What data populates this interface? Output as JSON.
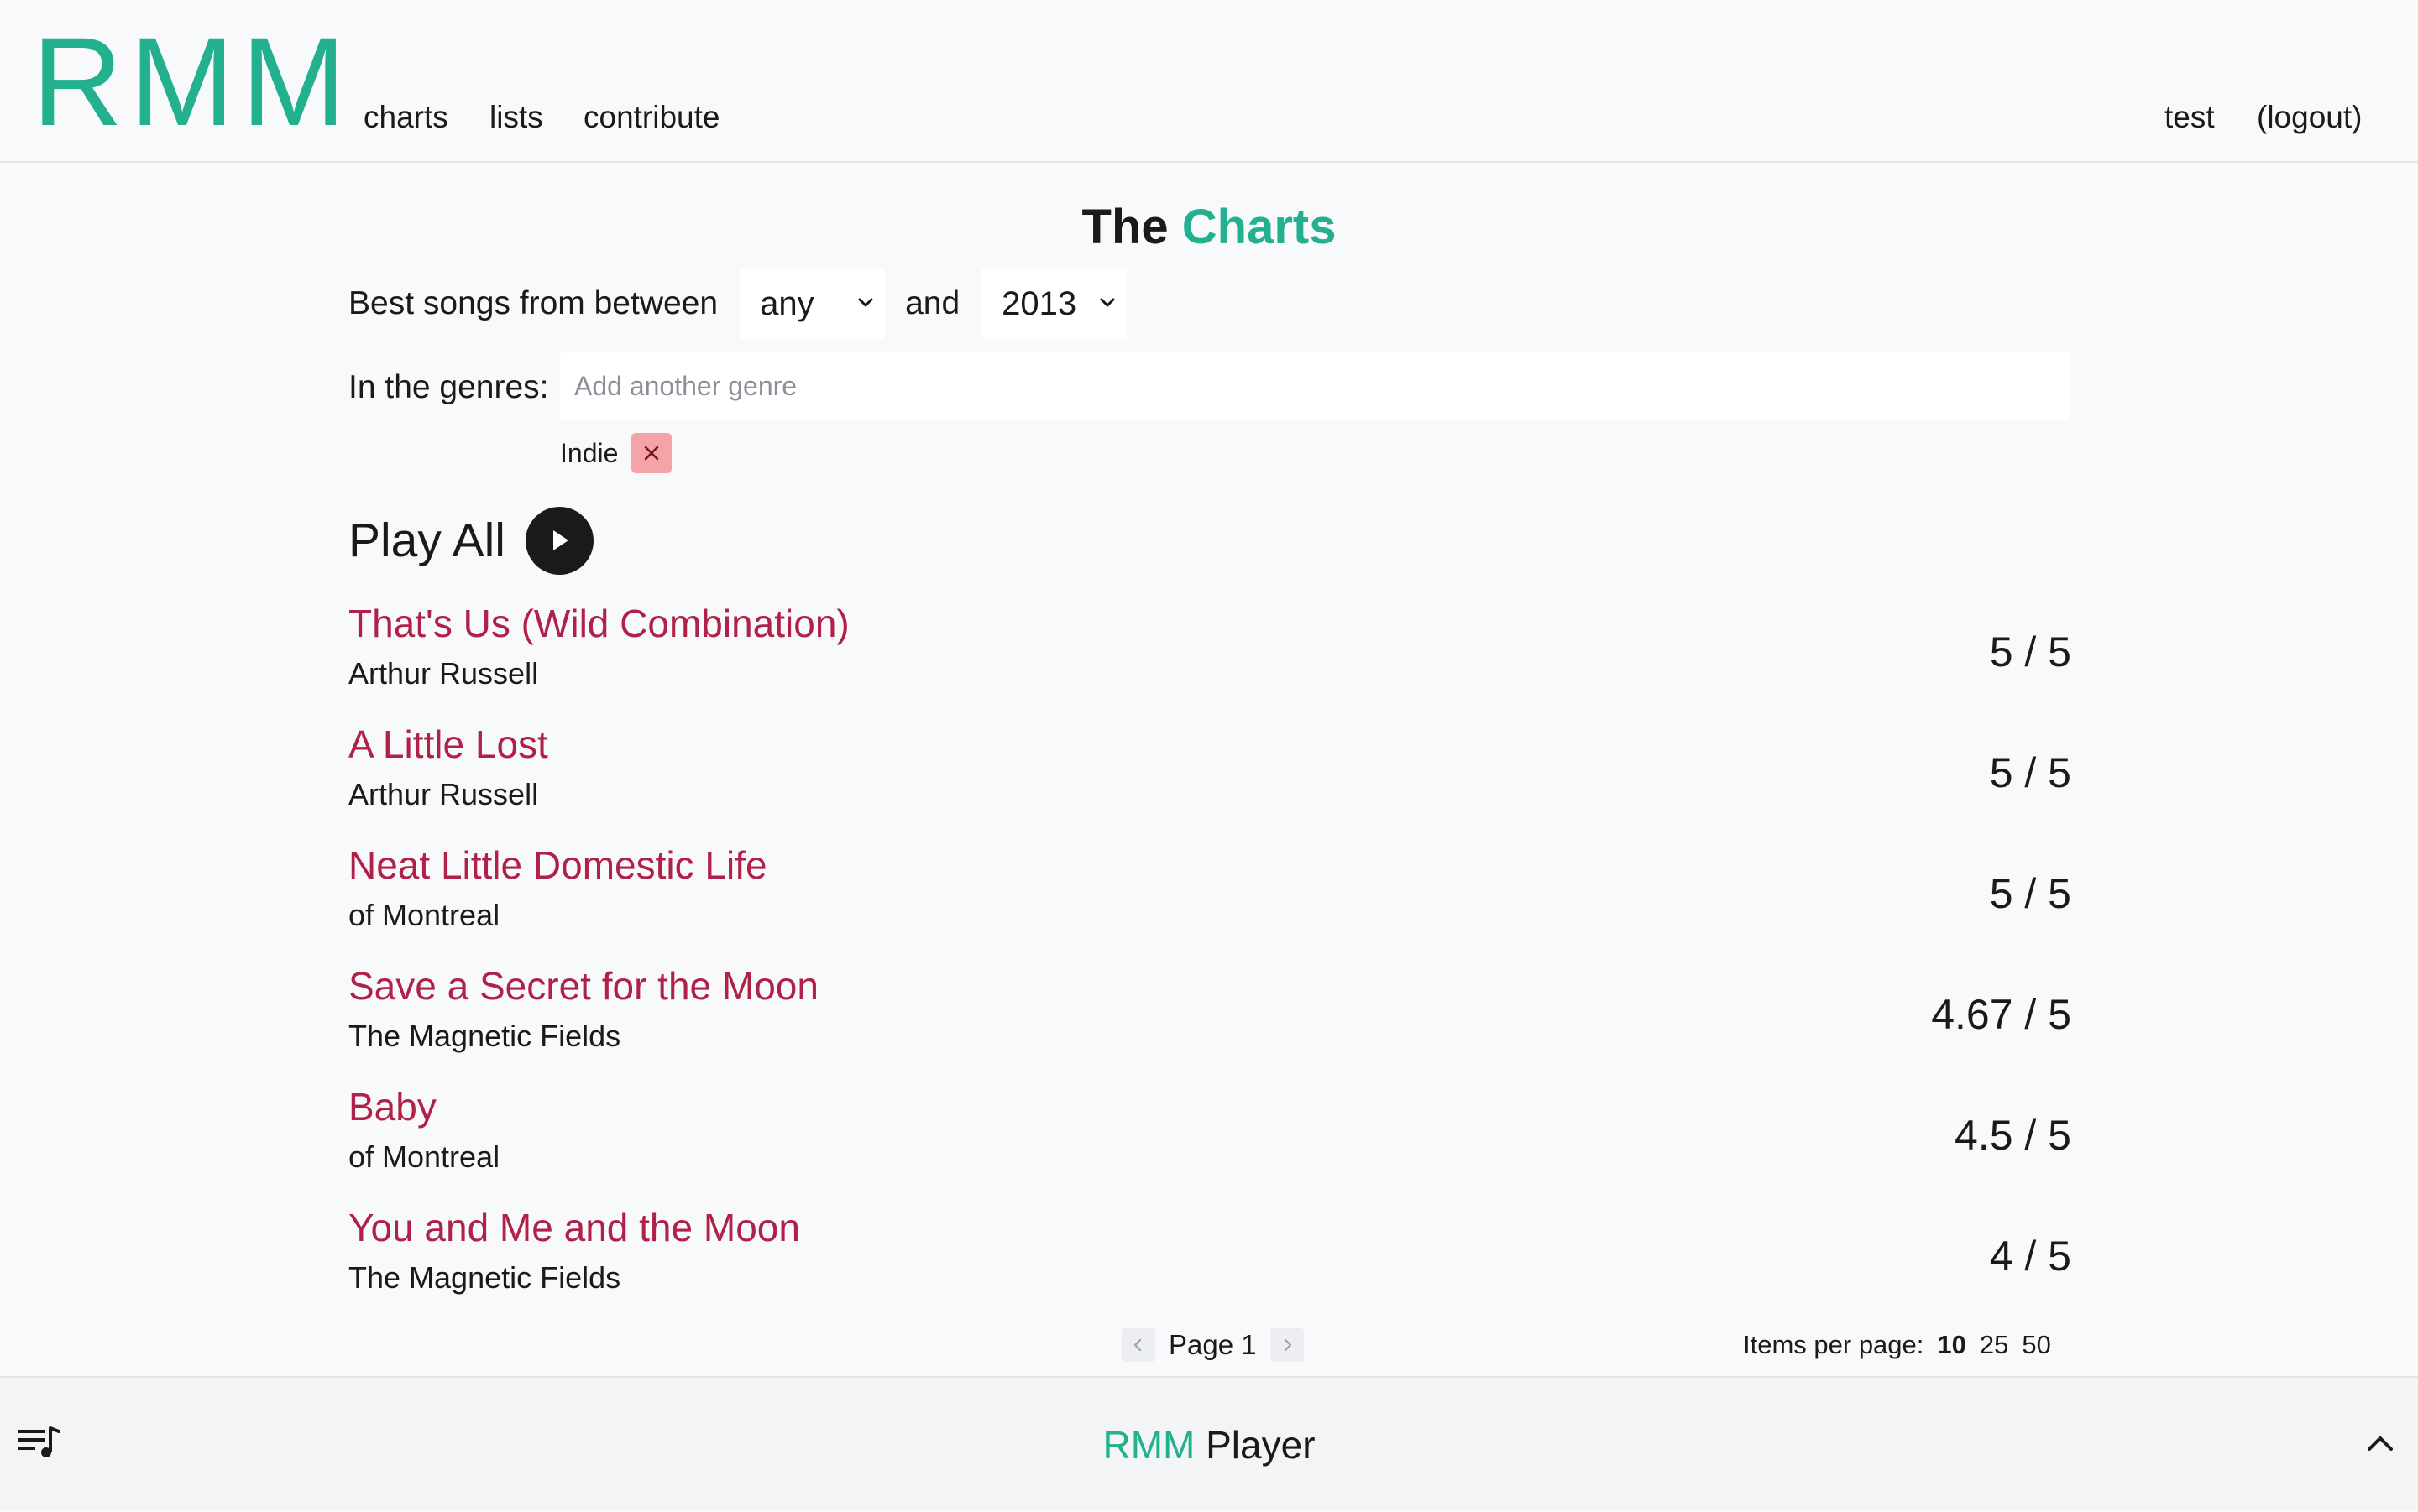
{
  "header": {
    "logo": "RMM",
    "nav": {
      "charts": "charts",
      "lists": "lists",
      "contribute": "contribute"
    },
    "user": "test",
    "logout": "(logout)"
  },
  "page": {
    "title_plain": "The",
    "title_accent": "Charts",
    "filter_prefix": "Best songs from between",
    "year_from": "any",
    "filter_and": "and",
    "year_to": "2013",
    "genres_label": "In the genres:",
    "genre_placeholder": "Add another genre",
    "genre_tags": [
      "Indie"
    ],
    "play_all": "Play All"
  },
  "songs": [
    {
      "title": "That's Us (Wild Combination)",
      "artist": "Arthur Russell",
      "rating": "5 / 5"
    },
    {
      "title": "A Little Lost",
      "artist": "Arthur Russell",
      "rating": "5 / 5"
    },
    {
      "title": "Neat Little Domestic Life",
      "artist": "of Montreal",
      "rating": "5 / 5"
    },
    {
      "title": "Save a Secret for the Moon",
      "artist": "The Magnetic Fields",
      "rating": "4.67 / 5"
    },
    {
      "title": "Baby",
      "artist": "of Montreal",
      "rating": "4.5 / 5"
    },
    {
      "title": "You and Me and the Moon",
      "artist": "The Magnetic Fields",
      "rating": "4 / 5"
    }
  ],
  "pagination": {
    "page_label": "Page 1",
    "per_page_label": "Items per page:",
    "options": [
      "10",
      "25",
      "50"
    ],
    "selected": "10"
  },
  "player": {
    "brand": "RMM",
    "label": "Player"
  },
  "icons": {
    "play": "play-icon",
    "remove_tag": "close-icon",
    "queue": "playlist-icon",
    "expand": "chevron-up-icon"
  },
  "colors": {
    "brand": "#22b08f",
    "song_title": "#b02148",
    "tag_remove_bg": "#f4a3a8"
  }
}
